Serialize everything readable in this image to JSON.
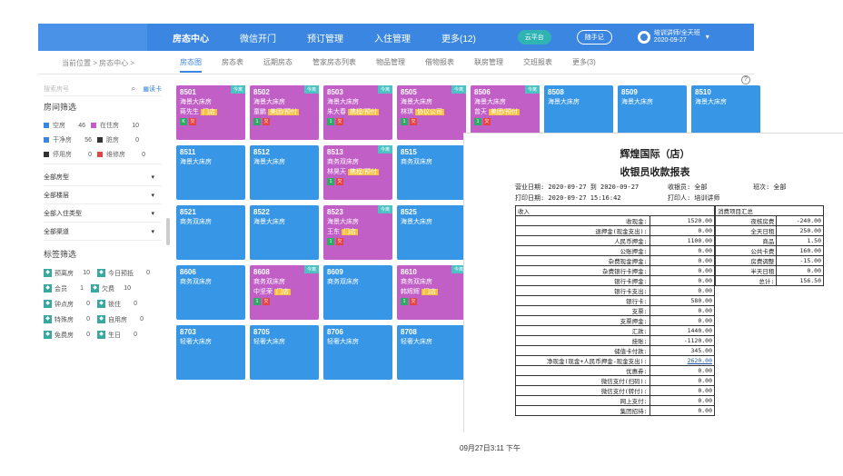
{
  "nav": {
    "items": [
      "房态中心",
      "微信开门",
      "预订管理",
      "入住管理",
      "更多(12)"
    ],
    "cloud": "云平台",
    "staff": "随手记",
    "user_name": "培训讲师/全天班",
    "user_date": "2020-09-27"
  },
  "subnav": {
    "breadcrumb": "当前位置 > 房态中心 >",
    "tabs": [
      "房态图",
      "房态表",
      "远期房态",
      "管家房态列表",
      "物品管理",
      "借物报表",
      "联房管理",
      "交班报表",
      "更多(3)"
    ]
  },
  "sidebar": {
    "search_placeholder": "搜索房号",
    "read_card": "读卡",
    "room_filter_title": "房间筛选",
    "stats": [
      [
        {
          "label": "空房",
          "n": "46",
          "color": "#3a86e0"
        },
        {
          "label": "在住房",
          "n": "10",
          "color": "#c15fc7"
        }
      ],
      [
        {
          "label": "干净房",
          "n": "56",
          "color": "#3a86e0"
        },
        {
          "label": "脏房",
          "n": "0",
          "color": "#333333"
        }
      ],
      [
        {
          "label": "停用房",
          "n": "0",
          "color": "#333333"
        },
        {
          "label": "维修房",
          "n": "0",
          "color": "#e34545"
        }
      ]
    ],
    "dropdowns": [
      "全部房型",
      "全部楼层",
      "全部入住类型",
      "全部渠道"
    ],
    "tag_filter_title": "标签筛选",
    "tags": [
      [
        {
          "label": "预离房",
          "n": "10"
        },
        {
          "label": "今日预抵",
          "n": "0"
        }
      ],
      [
        {
          "label": "会员",
          "n": "1"
        },
        {
          "label": "欠费",
          "n": "10"
        }
      ],
      [
        {
          "label": "钟点房",
          "n": "0"
        },
        {
          "label": "锁住",
          "n": "0"
        }
      ],
      [
        {
          "label": "特殊房",
          "n": "0"
        },
        {
          "label": "自用房",
          "n": "0"
        }
      ],
      [
        {
          "label": "免费房",
          "n": "0"
        },
        {
          "label": "生日",
          "n": "0"
        }
      ]
    ]
  },
  "rooms": [
    {
      "num": "8501",
      "type": "海景大床房",
      "guest": "蒋先生",
      "tag": "门店",
      "status": "purple",
      "today": "今离",
      "icons": [
        "K",
        "欠"
      ],
      "col": 0,
      "row": 0
    },
    {
      "num": "8502",
      "type": "海景大床房",
      "guest": "童鹏",
      "tag": "美团/预付",
      "status": "purple",
      "today": "今离",
      "icons": [
        "1",
        "欠"
      ],
      "col": 1,
      "row": 0
    },
    {
      "num": "8503",
      "type": "海景大床房",
      "guest": "朱大春",
      "tag": "携程/预付",
      "status": "purple",
      "today": "今离",
      "icons": [
        "1",
        "欠"
      ],
      "col": 2,
      "row": 0
    },
    {
      "num": "8505",
      "type": "海景大床房",
      "guest": "林琪",
      "tag": "协议公司",
      "status": "purple",
      "today": "今离",
      "icons": [
        "1",
        "欠"
      ],
      "col": 3,
      "row": 0
    },
    {
      "num": "8506",
      "type": "海景大床房",
      "guest": "曾天",
      "tag": "美团/预付",
      "status": "purple",
      "today": "今离",
      "icons": [
        "1",
        "欠"
      ],
      "col": 4,
      "row": 0
    },
    {
      "num": "8508",
      "type": "海景大床房",
      "guest": "",
      "tag": "",
      "status": "blue",
      "today": "",
      "icons": [],
      "col": 5,
      "row": 0
    },
    {
      "num": "8509",
      "type": "海景大床房",
      "guest": "",
      "tag": "",
      "status": "blue",
      "today": "",
      "icons": [],
      "col": 6,
      "row": 0
    },
    {
      "num": "8510",
      "type": "海景大床房",
      "guest": "",
      "tag": "",
      "status": "blue",
      "today": "",
      "icons": [],
      "col": 7,
      "row": 0
    },
    {
      "num": "8511",
      "type": "海景大床房",
      "guest": "",
      "tag": "",
      "status": "blue",
      "today": "",
      "icons": [],
      "col": 0,
      "row": 1
    },
    {
      "num": "8512",
      "type": "海景大床房",
      "guest": "",
      "tag": "",
      "status": "blue",
      "today": "",
      "icons": [],
      "col": 1,
      "row": 1
    },
    {
      "num": "8513",
      "type": "商务双床房",
      "guest": "林昊天",
      "tag": "携程/预付",
      "status": "purple",
      "today": "今离",
      "icons": [
        "1",
        "欠"
      ],
      "col": 2,
      "row": 1
    },
    {
      "num": "8515",
      "type": "商务双床房",
      "guest": "",
      "tag": "",
      "status": "blue",
      "today": "",
      "icons": [],
      "col": 3,
      "row": 1
    },
    {
      "num": "8521",
      "type": "商务双床房",
      "guest": "",
      "tag": "",
      "status": "blue",
      "today": "",
      "icons": [],
      "col": 0,
      "row": 2
    },
    {
      "num": "8522",
      "type": "海景大床房",
      "guest": "",
      "tag": "",
      "status": "blue",
      "today": "",
      "icons": [],
      "col": 1,
      "row": 2
    },
    {
      "num": "8523",
      "type": "海景大床房",
      "guest": "王东",
      "tag": "门店",
      "status": "purple",
      "today": "今离",
      "icons": [
        "1",
        "欠"
      ],
      "col": 2,
      "row": 2
    },
    {
      "num": "8525",
      "type": "海景大床房",
      "guest": "",
      "tag": "",
      "status": "blue",
      "today": "",
      "icons": [],
      "col": 3,
      "row": 2
    },
    {
      "num": "8606",
      "type": "商务双床房",
      "guest": "",
      "tag": "",
      "status": "blue",
      "today": "",
      "icons": [],
      "col": 0,
      "row": 3
    },
    {
      "num": "8608",
      "type": "商务双床房",
      "guest": "中坚荣",
      "tag": "门店",
      "status": "purple",
      "today": "今离",
      "icons": [
        "1",
        "欠"
      ],
      "col": 1,
      "row": 3
    },
    {
      "num": "8609",
      "type": "商务双床房",
      "guest": "",
      "tag": "",
      "status": "blue",
      "today": "",
      "icons": [],
      "col": 2,
      "row": 3
    },
    {
      "num": "8610",
      "type": "商务双床房",
      "guest": "韩辉辉",
      "tag": "门店",
      "status": "purple",
      "today": "今离",
      "icons": [
        "1",
        "欠"
      ],
      "col": 3,
      "row": 3
    },
    {
      "num": "8703",
      "type": "轻奢大床房",
      "guest": "",
      "tag": "",
      "status": "blue",
      "today": "",
      "icons": [],
      "col": 0,
      "row": 4
    },
    {
      "num": "8705",
      "type": "轻奢大床房",
      "guest": "",
      "tag": "",
      "status": "blue",
      "today": "",
      "icons": [],
      "col": 1,
      "row": 4
    },
    {
      "num": "8706",
      "type": "轻奢大床房",
      "guest": "",
      "tag": "",
      "status": "blue",
      "today": "",
      "icons": [],
      "col": 2,
      "row": 4
    },
    {
      "num": "8708",
      "type": "轻奢大床房",
      "guest": "",
      "tag": "",
      "status": "blue",
      "today": "",
      "icons": [],
      "col": 3,
      "row": 4
    }
  ],
  "report": {
    "title1": "辉煌国际（店）",
    "title2": "收银员收款报表",
    "business_date": "营业日期: 2020-09-27 到 2020-09-27",
    "cashier": "收银员: 全部",
    "shift": "班次: 全部",
    "print_date": "打印日期: 2020-09-27 15:16:42",
    "printer": "打印人: 培训讲师",
    "income_header": "收入",
    "income": [
      {
        "label": "收现金:",
        "value": "1520.00"
      },
      {
        "label": "退押金(现金支出):",
        "value": "0.00"
      },
      {
        "label": "人民币押金:",
        "value": "1100.00"
      },
      {
        "label": "公账押金:",
        "value": "0.00"
      },
      {
        "label": "杂费现金押金:",
        "value": "0.00"
      },
      {
        "label": "杂费银行卡押金:",
        "value": "0.00"
      },
      {
        "label": "银行卡押金:",
        "value": "0.00"
      },
      {
        "label": "银行卡支出:",
        "value": "0.00"
      },
      {
        "label": "银行卡:",
        "value": "580.00"
      },
      {
        "label": "支票:",
        "value": "0.00"
      },
      {
        "label": "支票押金:",
        "value": "0.00"
      },
      {
        "label": "汇款:",
        "value": "1440.00"
      },
      {
        "label": "挂账:",
        "value": "-1120.00"
      },
      {
        "label": "储值卡付款:",
        "value": "345.00"
      },
      {
        "label": "净现金(现金+人民币押金-现金支出):",
        "value": "2620.00",
        "link": true
      },
      {
        "label": "优惠券:",
        "value": "0.00"
      },
      {
        "label": "微信支付(扫码):",
        "value": "0.00"
      },
      {
        "label": "微信支付(转付):",
        "value": "0.00"
      },
      {
        "label": "网上支付:",
        "value": "0.00"
      },
      {
        "label": "集团招待:",
        "value": "0.00"
      }
    ],
    "consume_header": "消费项目汇总",
    "consume": [
      {
        "label": "夜核房费",
        "value": "-240.00"
      },
      {
        "label": "全天日租",
        "value": "250.00"
      },
      {
        "label": "商品",
        "value": "1.50"
      },
      {
        "label": "公共卡费",
        "value": "160.00"
      },
      {
        "label": "房费调整",
        "value": "-15.00"
      },
      {
        "label": "半天日租",
        "value": "0.00"
      },
      {
        "label": "总计:",
        "value": "156.50"
      }
    ]
  },
  "timestamp": "09月27日3:11 下午"
}
